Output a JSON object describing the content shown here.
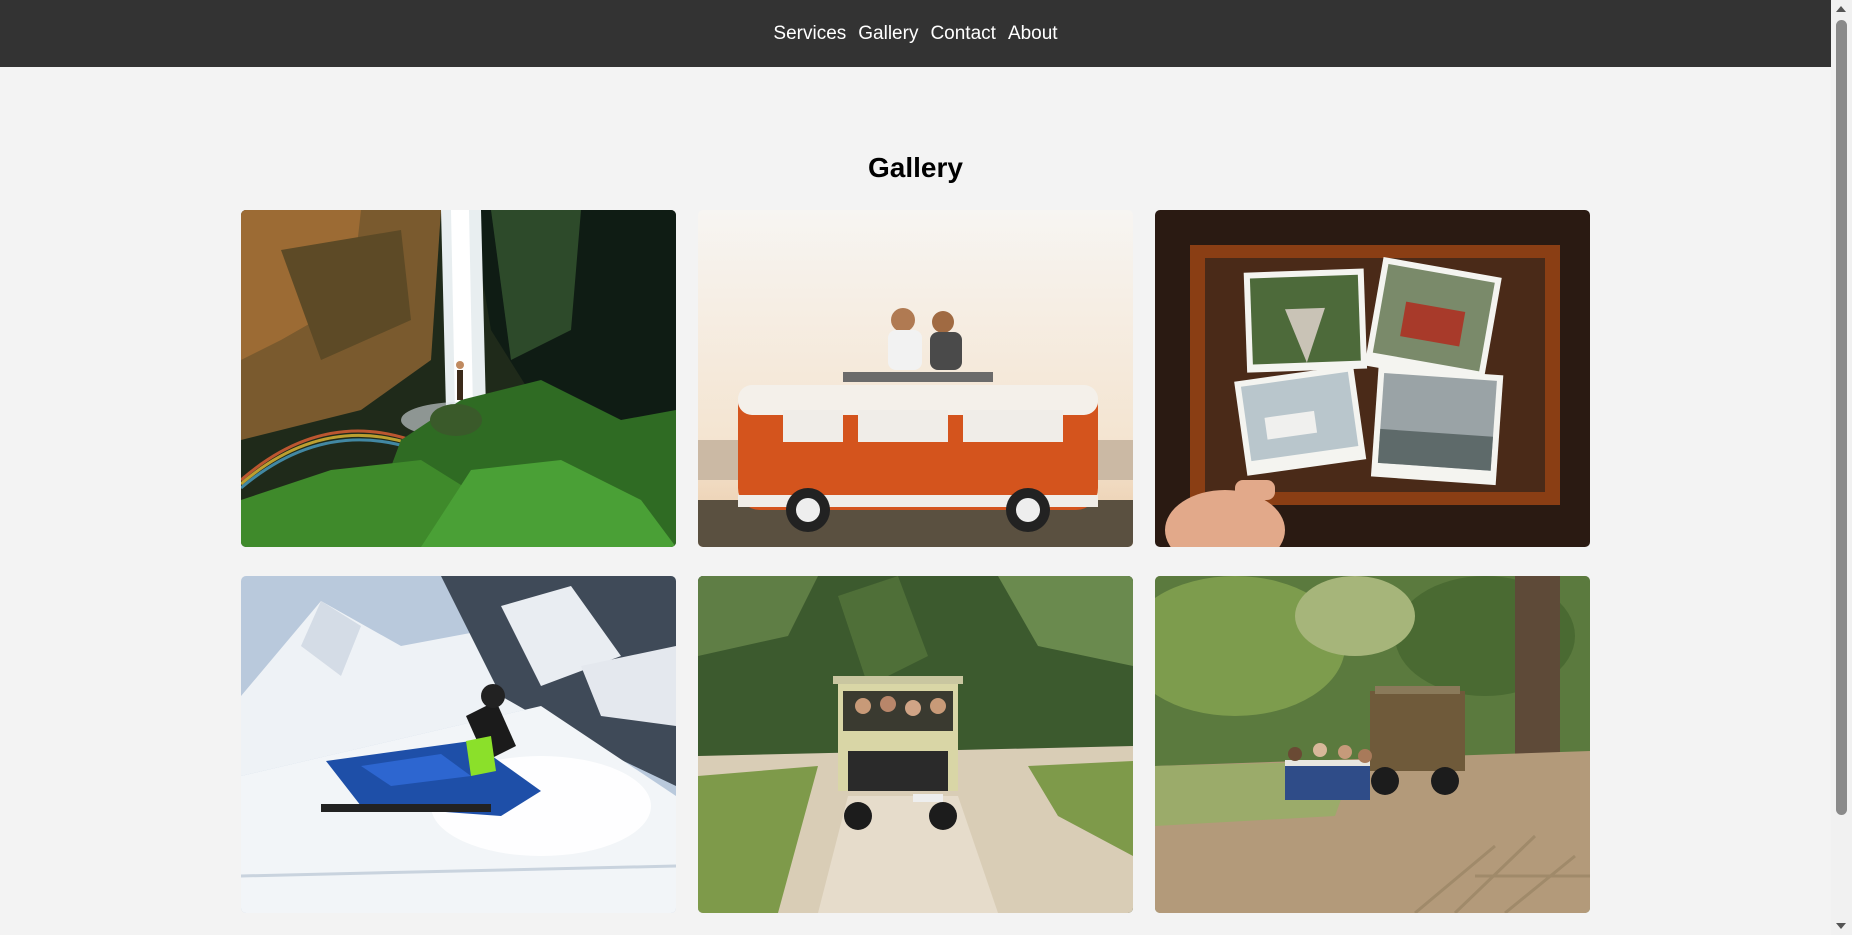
{
  "nav": {
    "items": [
      {
        "label": "Services"
      },
      {
        "label": "Gallery"
      },
      {
        "label": "Contact"
      },
      {
        "label": "About"
      }
    ]
  },
  "gallery": {
    "title": "Gallery"
  },
  "colors": {
    "nav_bg": "#333333",
    "page_bg": "#f3f3f3",
    "nav_text": "#ffffff"
  }
}
